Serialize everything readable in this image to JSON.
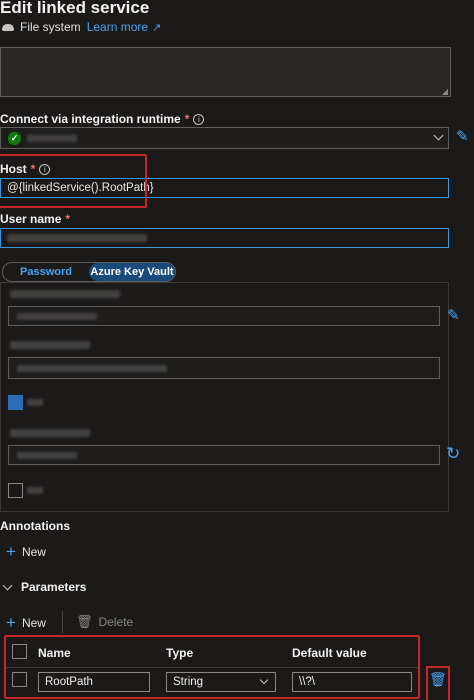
{
  "header": {
    "title": "Edit linked service",
    "subtitle": "File system",
    "learn_more": "Learn more"
  },
  "runtime": {
    "label": "Connect via integration runtime",
    "required_mark": "*"
  },
  "host": {
    "label": "Host",
    "required_mark": "*",
    "value": "@{linkedService().RootPath}"
  },
  "username": {
    "label": "User name",
    "required_mark": "*"
  },
  "auth_toggle": {
    "password": "Password",
    "key_vault": "Azure Key Vault",
    "selected": "Azure Key Vault"
  },
  "annotations": {
    "label": "Annotations",
    "new_label": "New"
  },
  "parameters": {
    "label": "Parameters",
    "new_label": "New",
    "delete_label": "Delete",
    "columns": [
      "Name",
      "Type",
      "Default value"
    ],
    "rows": [
      {
        "name": "RootPath",
        "type": "String",
        "default_value": "\\\\?\\"
      }
    ]
  },
  "colors": {
    "accent": "#4aa3f0",
    "highlight_border": "#c4272c",
    "success": "#107c10"
  }
}
